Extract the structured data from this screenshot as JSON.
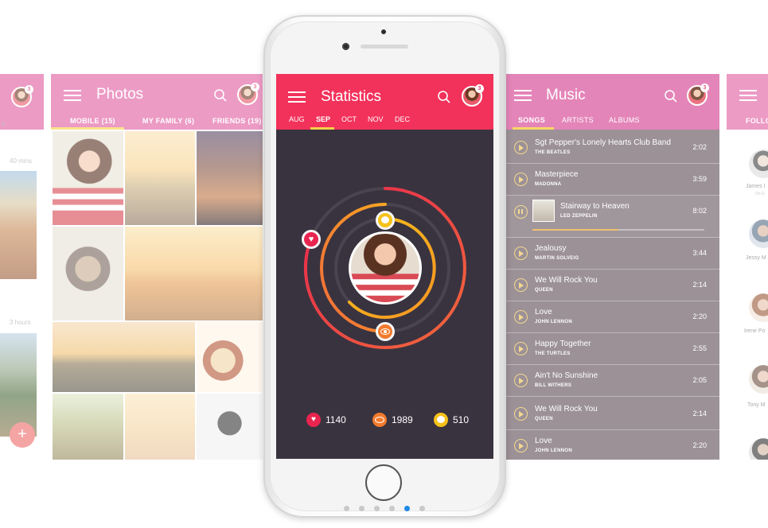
{
  "colors": {
    "accent": "#f2325b",
    "pink": "#e15fa3",
    "music_bg": "#8a7e86",
    "stat_bg": "#39333f",
    "heart": "#e8244f",
    "eye": "#f27a2c",
    "comment": "#f6c21a"
  },
  "left_edge": {
    "avatar_badge": "3",
    "time_1": "40 mins",
    "time_2": "3 hours",
    "fab_label": "+",
    "truncated_text": "s"
  },
  "photos": {
    "title": "Photos",
    "avatar_badge": "3",
    "tabs": [
      {
        "label": "MOBILE (15)",
        "active": true
      },
      {
        "label": "MY FAMILY (6)",
        "active": false
      },
      {
        "label": "FRIENDS (19)",
        "active": false
      }
    ]
  },
  "statistics": {
    "title": "Statistics",
    "avatar_badge": "3",
    "months": [
      {
        "label": "AUG",
        "active": false
      },
      {
        "label": "SEP",
        "active": true
      },
      {
        "label": "OCT",
        "active": false
      },
      {
        "label": "NOV",
        "active": false
      },
      {
        "label": "DEC",
        "active": false
      }
    ],
    "likes": "1140",
    "views": "1989",
    "comments": "510"
  },
  "music": {
    "title": "Music",
    "avatar_badge": "3",
    "tabs": [
      {
        "label": "SONGS",
        "active": true
      },
      {
        "label": "ARTISTS",
        "active": false
      },
      {
        "label": "ALBUMS",
        "active": false
      }
    ],
    "now_playing_progress": 0.5,
    "songs": [
      {
        "title": "Sgt Pepper's Lonely Hearts Club Band",
        "artist": "THE BEATLES",
        "duration": "2:02"
      },
      {
        "title": "Masterpiece",
        "artist": "MADONNA",
        "duration": "3:59"
      },
      {
        "title": "Stairway to Heaven",
        "artist": "LED ZEPPELIN",
        "duration": "8:02"
      },
      {
        "title": "Jealousy",
        "artist": "MARTIN SOLVEIG",
        "duration": "3:44"
      },
      {
        "title": "We Will Rock You",
        "artist": "QUEEN",
        "duration": "2:14"
      },
      {
        "title": "Love",
        "artist": "JOHN LENNON",
        "duration": "2:20"
      },
      {
        "title": "Happy Together",
        "artist": "THE TURTLES",
        "duration": "2:55"
      },
      {
        "title": "Ain't No Sunshine",
        "artist": "BILL WITHERS",
        "duration": "2:05"
      },
      {
        "title": "We Will Rock You",
        "artist": "QUEEN",
        "duration": "2:14"
      },
      {
        "title": "Love",
        "artist": "JOHN LENNON",
        "duration": "2:20"
      }
    ]
  },
  "right_edge": {
    "tab_label": "FOLLO",
    "people": [
      {
        "name": "James I",
        "sub": "On G"
      },
      {
        "name": "Jessy M",
        "sub": ""
      },
      {
        "name": "Irene Po",
        "sub": ""
      },
      {
        "name": "Tony M",
        "sub": ""
      }
    ]
  },
  "pager": {
    "total": 6,
    "active_index": 4
  }
}
